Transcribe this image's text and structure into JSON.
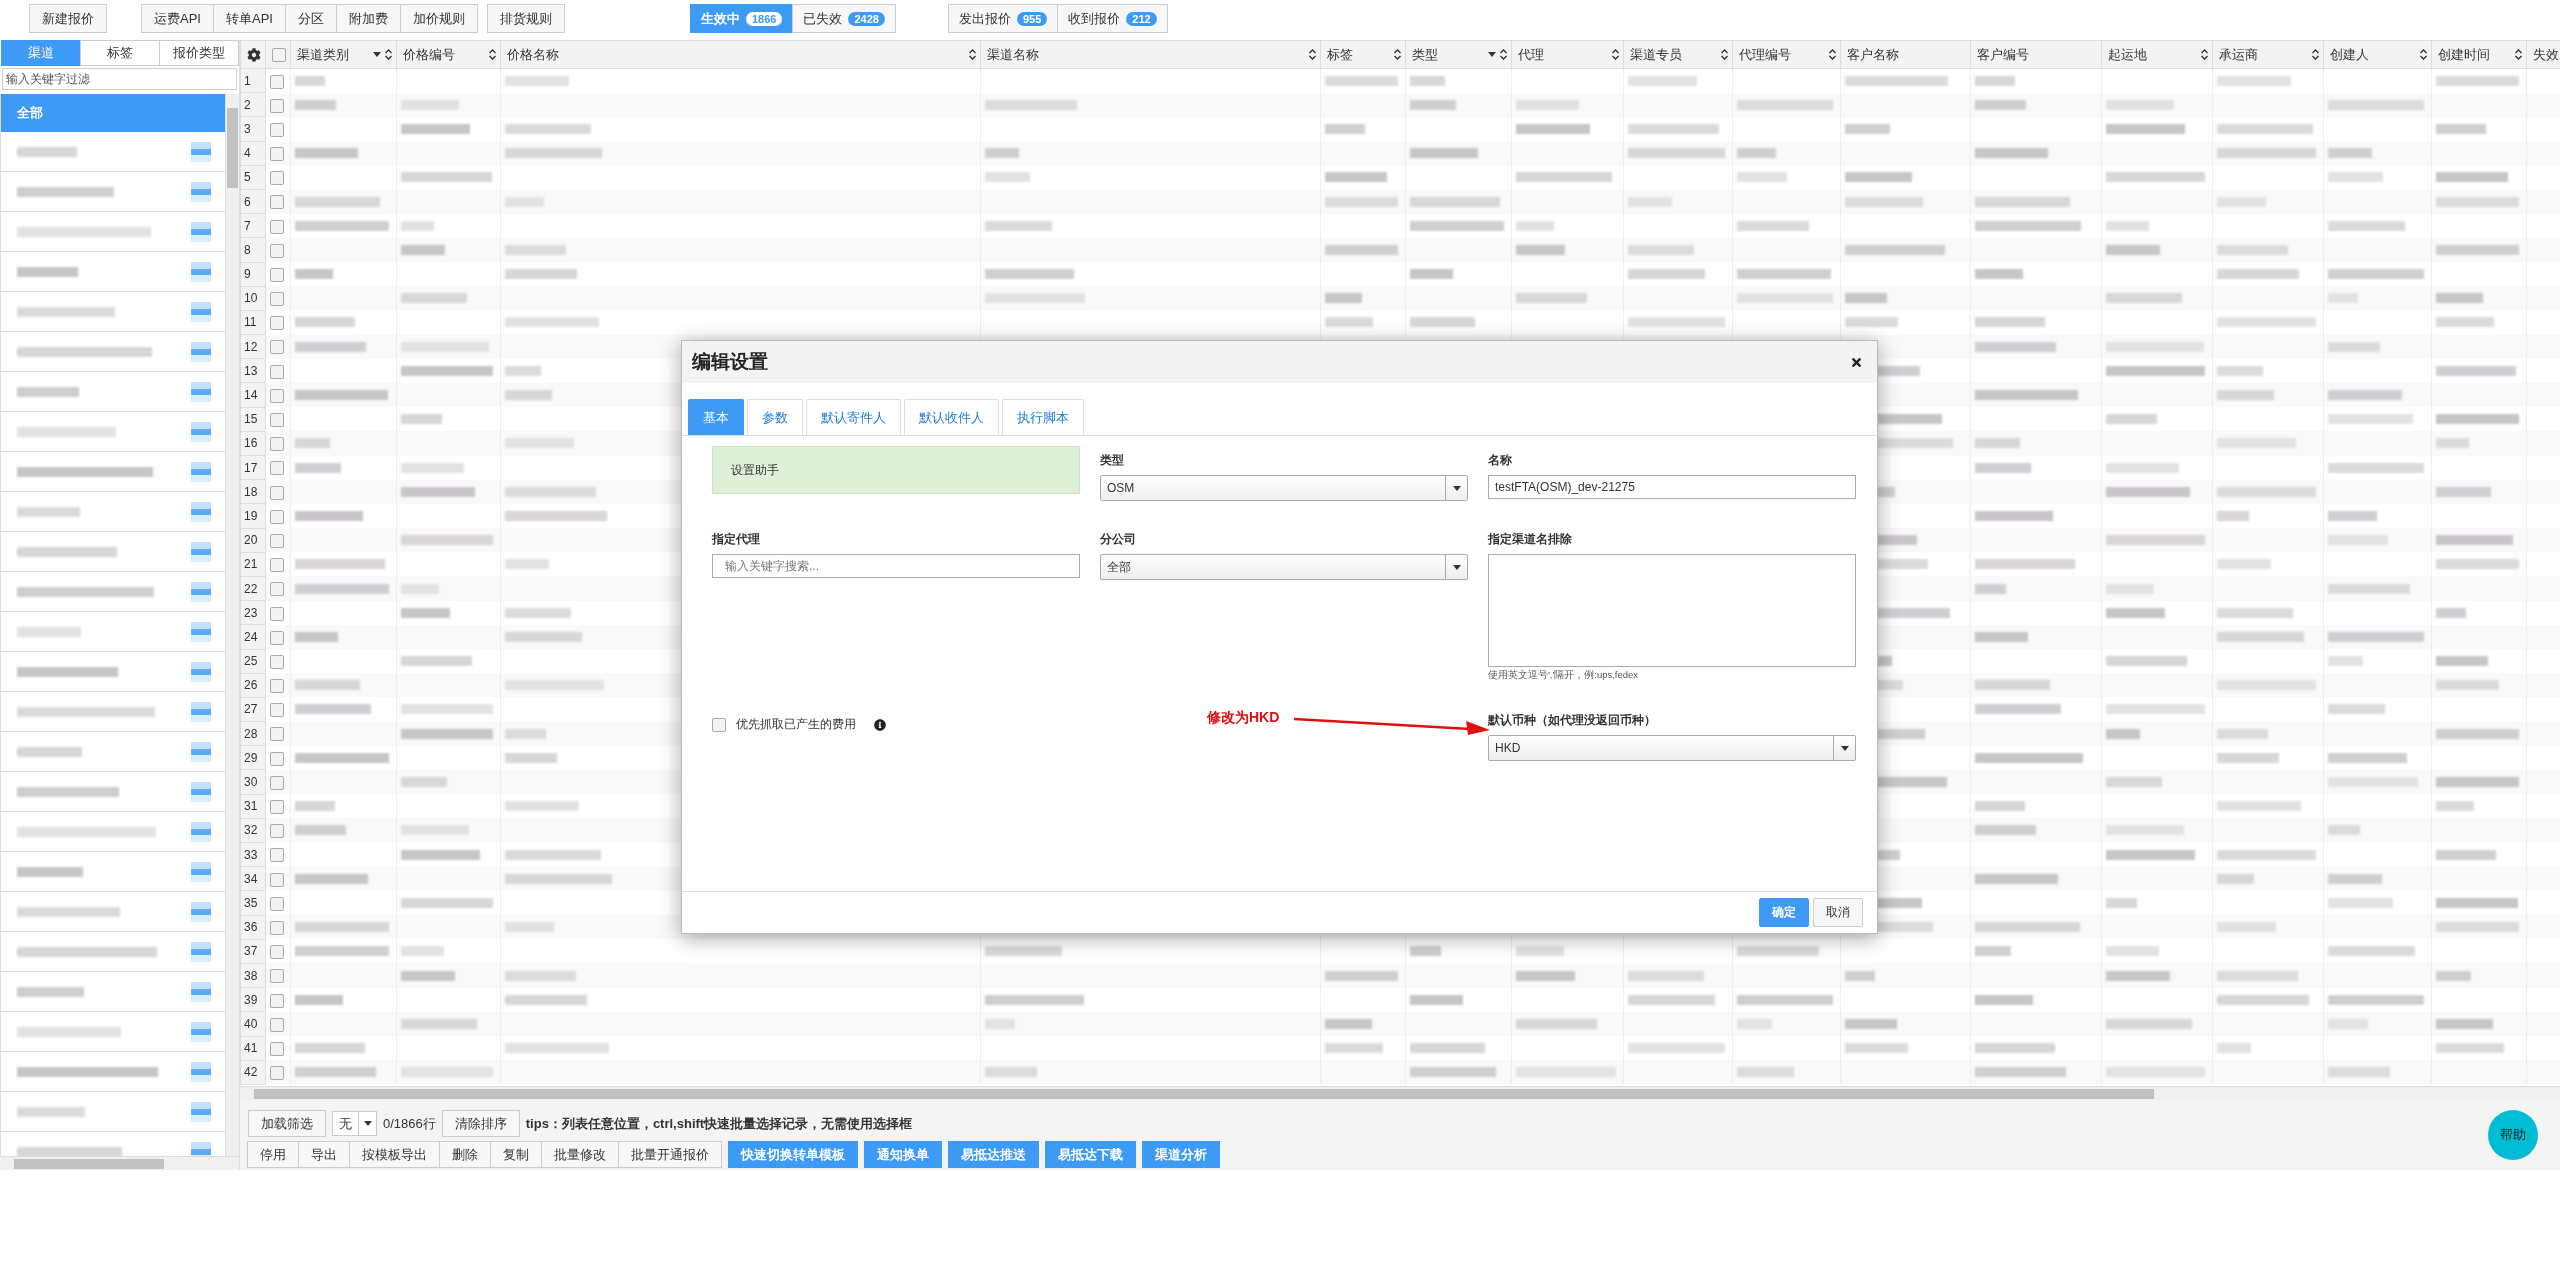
{
  "toolbar": {
    "groups": [
      [
        "新建报价"
      ],
      [
        "运费API",
        "转单API",
        "分区",
        "附加费",
        "加价规则"
      ],
      [
        "排货规则"
      ]
    ],
    "status_toggle": [
      {
        "label": "生效中",
        "count": "1866",
        "selected": true
      },
      {
        "label": "已失效",
        "count": "2428",
        "selected": false
      }
    ],
    "quote_toggle": [
      {
        "label": "发出报价",
        "count": "955"
      },
      {
        "label": "收到报价",
        "count": "212"
      }
    ]
  },
  "sidebar": {
    "tabs": [
      {
        "label": "渠道",
        "selected": true
      },
      {
        "label": "标签",
        "selected": false
      },
      {
        "label": "报价类型",
        "selected": false
      }
    ],
    "filter_placeholder": "输入关键字过滤",
    "items": [
      {
        "label": "全部",
        "selected": true
      }
    ]
  },
  "table": {
    "select_all_checked": false,
    "columns": [
      {
        "label": "渠道类别",
        "filter": true,
        "sortable": true
      },
      {
        "label": "价格编号",
        "filter": false,
        "sortable": true
      },
      {
        "label": "价格名称",
        "filter": false,
        "sortable": true
      },
      {
        "label": "渠道名称",
        "filter": false,
        "sortable": true
      },
      {
        "label": "标签",
        "filter": false,
        "sortable": true
      },
      {
        "label": "类型",
        "filter": true,
        "sortable": true
      },
      {
        "label": "代理",
        "filter": false,
        "sortable": true
      },
      {
        "label": "渠道专员",
        "filter": false,
        "sortable": true
      },
      {
        "label": "代理编号",
        "filter": false,
        "sortable": true
      },
      {
        "label": "客户名称",
        "filter": false,
        "sortable": false
      },
      {
        "label": "客户编号",
        "filter": false,
        "sortable": false
      },
      {
        "label": "起运地",
        "filter": false,
        "sortable": true
      },
      {
        "label": "承运商",
        "filter": false,
        "sortable": true
      },
      {
        "label": "创建人",
        "filter": false,
        "sortable": true
      },
      {
        "label": "创建时间",
        "filter": false,
        "sortable": true
      },
      {
        "label": "失效"
      }
    ],
    "rows": [
      {
        "number": "1",
        "checked": false
      },
      {
        "number": "2",
        "checked": false
      },
      {
        "number": "3",
        "checked": false
      },
      {
        "number": "4",
        "checked": false
      },
      {
        "number": "5",
        "checked": false
      },
      {
        "number": "6",
        "checked": false
      },
      {
        "number": "7",
        "checked": false
      },
      {
        "number": "8",
        "checked": false
      },
      {
        "number": "9",
        "checked": false
      },
      {
        "number": "10",
        "checked": false
      },
      {
        "number": "11",
        "checked": false
      },
      {
        "number": "12",
        "checked": false
      },
      {
        "number": "13",
        "checked": false
      },
      {
        "number": "14",
        "checked": false
      },
      {
        "number": "15",
        "checked": false
      },
      {
        "number": "16",
        "checked": false
      },
      {
        "number": "17",
        "checked": false
      },
      {
        "number": "18",
        "checked": false
      },
      {
        "number": "19",
        "checked": false
      },
      {
        "number": "20",
        "checked": false
      },
      {
        "number": "21",
        "checked": false
      },
      {
        "number": "22",
        "checked": false
      },
      {
        "number": "23",
        "checked": false
      },
      {
        "number": "24",
        "checked": false
      },
      {
        "number": "25",
        "checked": false
      },
      {
        "number": "26",
        "checked": false
      },
      {
        "number": "27",
        "checked": false
      },
      {
        "number": "28",
        "checked": false
      },
      {
        "number": "29",
        "checked": false
      },
      {
        "number": "30",
        "checked": false
      },
      {
        "number": "31",
        "checked": false
      },
      {
        "number": "32",
        "checked": false
      },
      {
        "number": "33",
        "checked": false
      },
      {
        "number": "34",
        "checked": false
      },
      {
        "number": "35",
        "checked": false
      },
      {
        "number": "36",
        "checked": false
      },
      {
        "number": "37",
        "checked": false
      },
      {
        "number": "38",
        "checked": false
      },
      {
        "number": "39",
        "checked": false
      },
      {
        "number": "40",
        "checked": false
      },
      {
        "number": "41",
        "checked": false
      },
      {
        "number": "42",
        "checked": false
      }
    ]
  },
  "bottom": {
    "load_filter": "加载筛选",
    "filter_select": "无",
    "count": "0/1866行",
    "clear_sort": "清除排序",
    "tips": "tips：列表任意位置，ctrl,shift快速批量选择记录，无需使用选择框",
    "actions": [
      {
        "label": "停用",
        "primary": false
      },
      {
        "label": "导出",
        "primary": false
      },
      {
        "label": "按模板导出",
        "primary": false
      },
      {
        "label": "删除",
        "primary": false
      },
      {
        "label": "复制",
        "primary": false
      },
      {
        "label": "批量修改",
        "primary": false
      },
      {
        "label": "批量开通报价",
        "primary": false
      },
      {
        "label": "快速切换转单模板",
        "primary": true
      },
      {
        "label": "通知换单",
        "primary": true
      },
      {
        "label": "易抵达推送",
        "primary": true
      },
      {
        "label": "易抵达下载",
        "primary": true
      },
      {
        "label": "渠道分析",
        "primary": true
      }
    ]
  },
  "help_button": "帮助",
  "modal": {
    "title": "编辑设置",
    "tabs": [
      {
        "label": "基本",
        "selected": true
      },
      {
        "label": "参数",
        "selected": false
      },
      {
        "label": "默认寄件人",
        "selected": false
      },
      {
        "label": "默认收件人",
        "selected": false
      },
      {
        "label": "执行脚本",
        "selected": false
      }
    ],
    "fields": [
      {
        "kind": "helper",
        "text": "设置助手"
      },
      {
        "kind": "select",
        "label": "类型",
        "value": "OSM"
      },
      {
        "kind": "input",
        "label": "名称",
        "value": "testFTA(OSM)_dev-21275"
      },
      {
        "kind": "search",
        "label": "指定代理",
        "placeholder": "输入关键字搜索..."
      },
      {
        "kind": "select",
        "label": "分公司",
        "value": "全部"
      },
      {
        "kind": "textarea",
        "label": "指定渠道名排除",
        "hint": "使用英文逗号','隔开，例:ups,fedex"
      },
      {
        "kind": "checkbox",
        "label": "优先抓取已产生的费用",
        "checked": false
      },
      {
        "kind": "select",
        "label": "默认币种（如代理没返回币种）",
        "value": "HKD"
      }
    ],
    "buttons": [
      {
        "label": "确定",
        "primary": true
      },
      {
        "label": "取消",
        "primary": false
      }
    ]
  },
  "annotation": {
    "text": "修改为HKD"
  }
}
